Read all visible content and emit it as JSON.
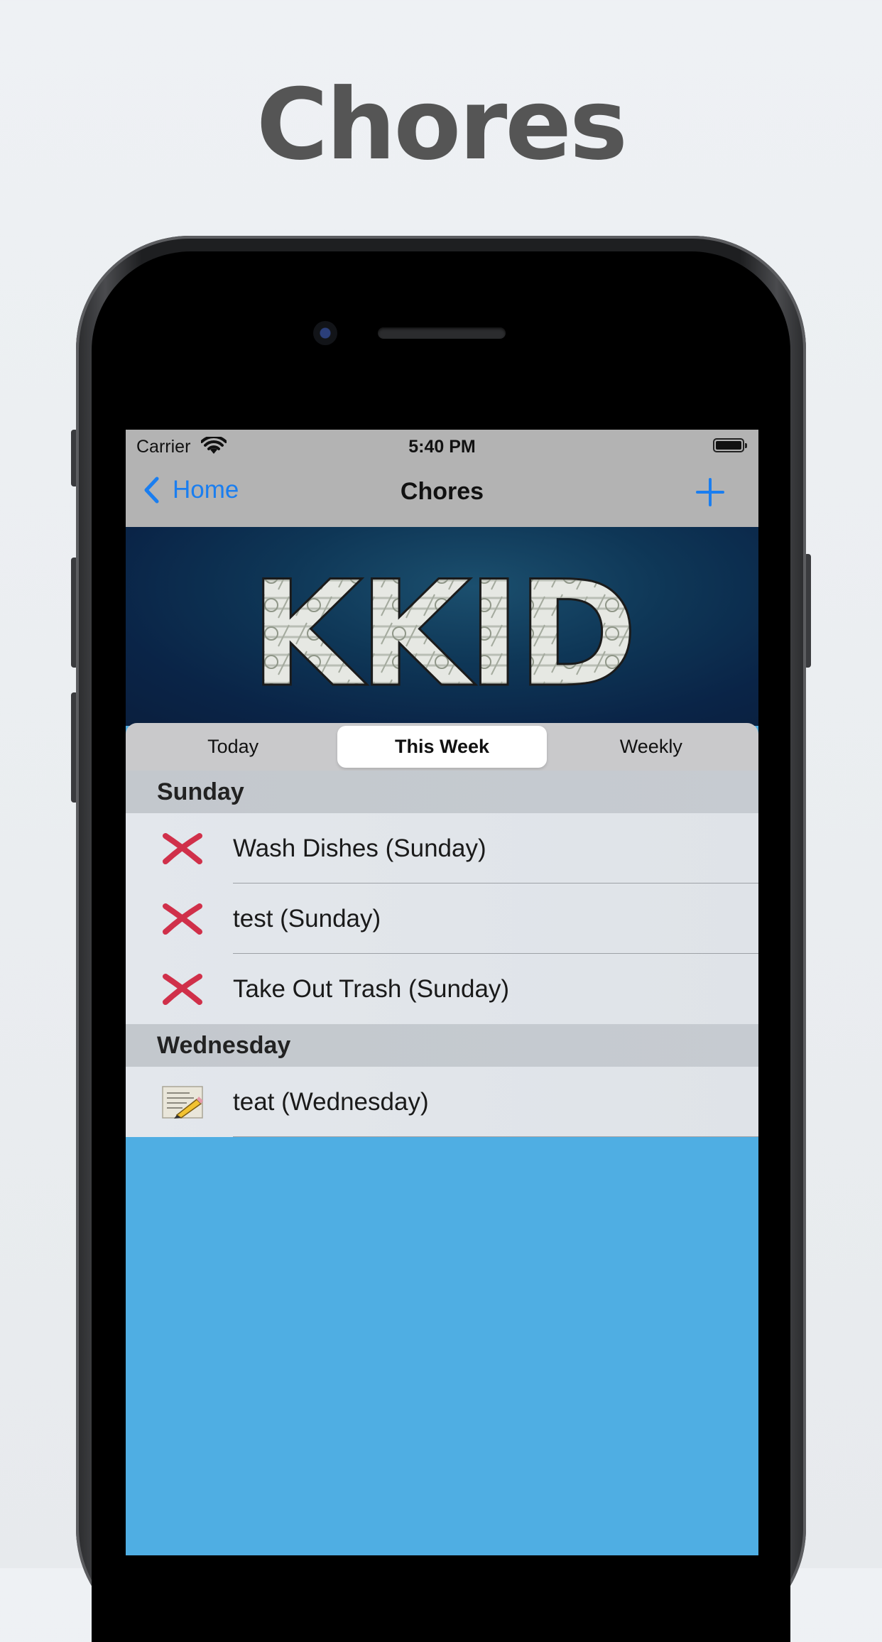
{
  "promo": {
    "title": "Chores"
  },
  "status": {
    "carrier": "Carrier",
    "time": "5:40 PM"
  },
  "nav": {
    "back_label": "Home",
    "title": "Chores"
  },
  "banner": {
    "logo_text": "KKID"
  },
  "tabs": [
    {
      "label": "Today",
      "selected": false
    },
    {
      "label": "This Week",
      "selected": true
    },
    {
      "label": "Weekly",
      "selected": false
    }
  ],
  "sections": [
    {
      "title": "Sunday",
      "items": [
        {
          "label": "Wash Dishes (Sunday)",
          "icon": "x-mark-icon"
        },
        {
          "label": "test (Sunday)",
          "icon": "x-mark-icon"
        },
        {
          "label": "Take Out Trash (Sunday)",
          "icon": "x-mark-icon"
        }
      ]
    },
    {
      "title": "Wednesday",
      "items": [
        {
          "label": "teat (Wednesday)",
          "icon": "memo-pencil-icon"
        }
      ]
    }
  ],
  "colors": {
    "accent": "#1a7ef0",
    "x_mark": "#d0304a",
    "screen_bg": "#4faee3"
  }
}
